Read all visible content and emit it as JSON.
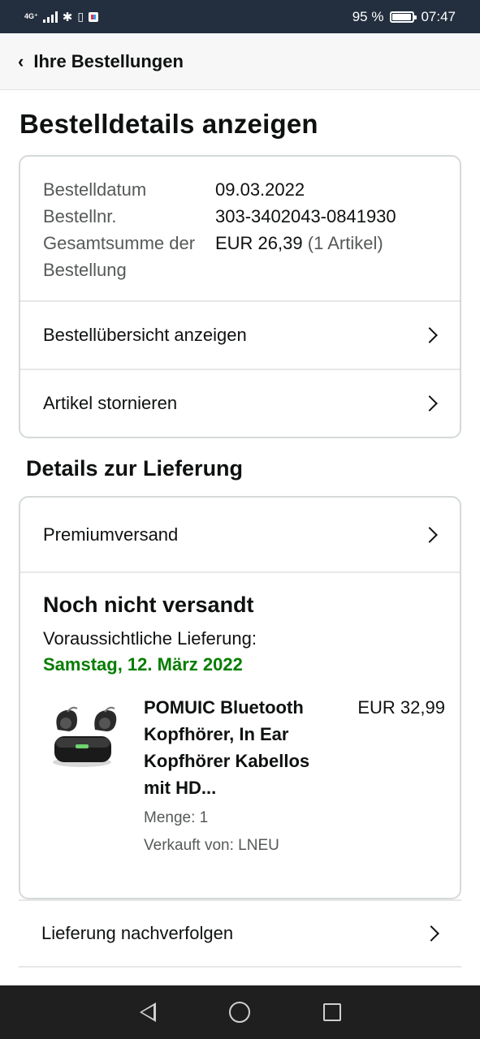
{
  "status_bar": {
    "network": "4G⁺",
    "battery_percent": "95 %",
    "battery_level": 0.95,
    "time": "07:47"
  },
  "header": {
    "back_label": "Ihre Bestellungen"
  },
  "page_title": "Bestelldetails anzeigen",
  "order_info": {
    "date_label": "Bestelldatum",
    "date_value": "09.03.2022",
    "number_label": "Bestellnr.",
    "number_value": "303-3402043-0841930",
    "total_label": "Gesamtsumme der Bestellung",
    "total_value": "EUR 26,39",
    "total_items": "(1 Artikel)"
  },
  "order_actions": [
    {
      "label": "Bestellübersicht anzeigen"
    },
    {
      "label": "Artikel stornieren"
    }
  ],
  "delivery": {
    "section_title": "Details zur Lieferung",
    "shipping_method": "Premiumversand",
    "status": "Noch nicht versandt",
    "expected_label": "Voraussichtliche Lieferung:",
    "expected_date": "Samstag, 12. März 2022",
    "item": {
      "title": "POMUIC Bluetooth Kopfhörer, In Ear Kopfhörer Kabellos mit HD...",
      "price": "EUR 32,99",
      "quantity": "Menge: 1",
      "seller": "Verkauft von: LNEU"
    },
    "track_label": "Lieferung nachverfolgen"
  },
  "colors": {
    "header_bg": "#232f3e",
    "delivery_green": "#067d00",
    "card_border": "#d5d9d9"
  }
}
